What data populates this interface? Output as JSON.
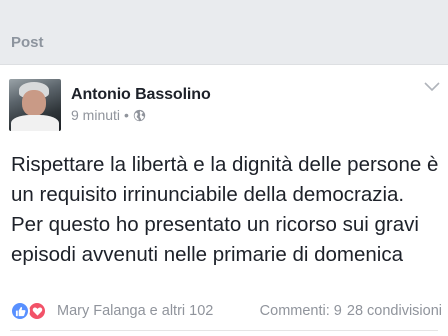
{
  "section": {
    "title": "Post"
  },
  "post": {
    "author": "Antonio Bassolino",
    "time": "9 minuti",
    "separator": "•",
    "privacy_icon": "globe-icon",
    "menu_icon": "chevron-down-icon",
    "text": "Rispettare la libertà e la dignità delle persone è un requisito irrinunciabile della democrazia. Per questo ho presentato un ricorso sui gravi episodi avvenuti nelle primarie di domenica"
  },
  "footer": {
    "reactions": [
      "like-icon",
      "love-icon"
    ],
    "reactors": "Mary Falanga e altri 102",
    "comments": "Commenti: 9",
    "shares": "28 condivisioni"
  },
  "colors": {
    "background": "#e9ebee",
    "like": "#5890ff",
    "love": "#f25268",
    "meta_text": "#90949c"
  }
}
